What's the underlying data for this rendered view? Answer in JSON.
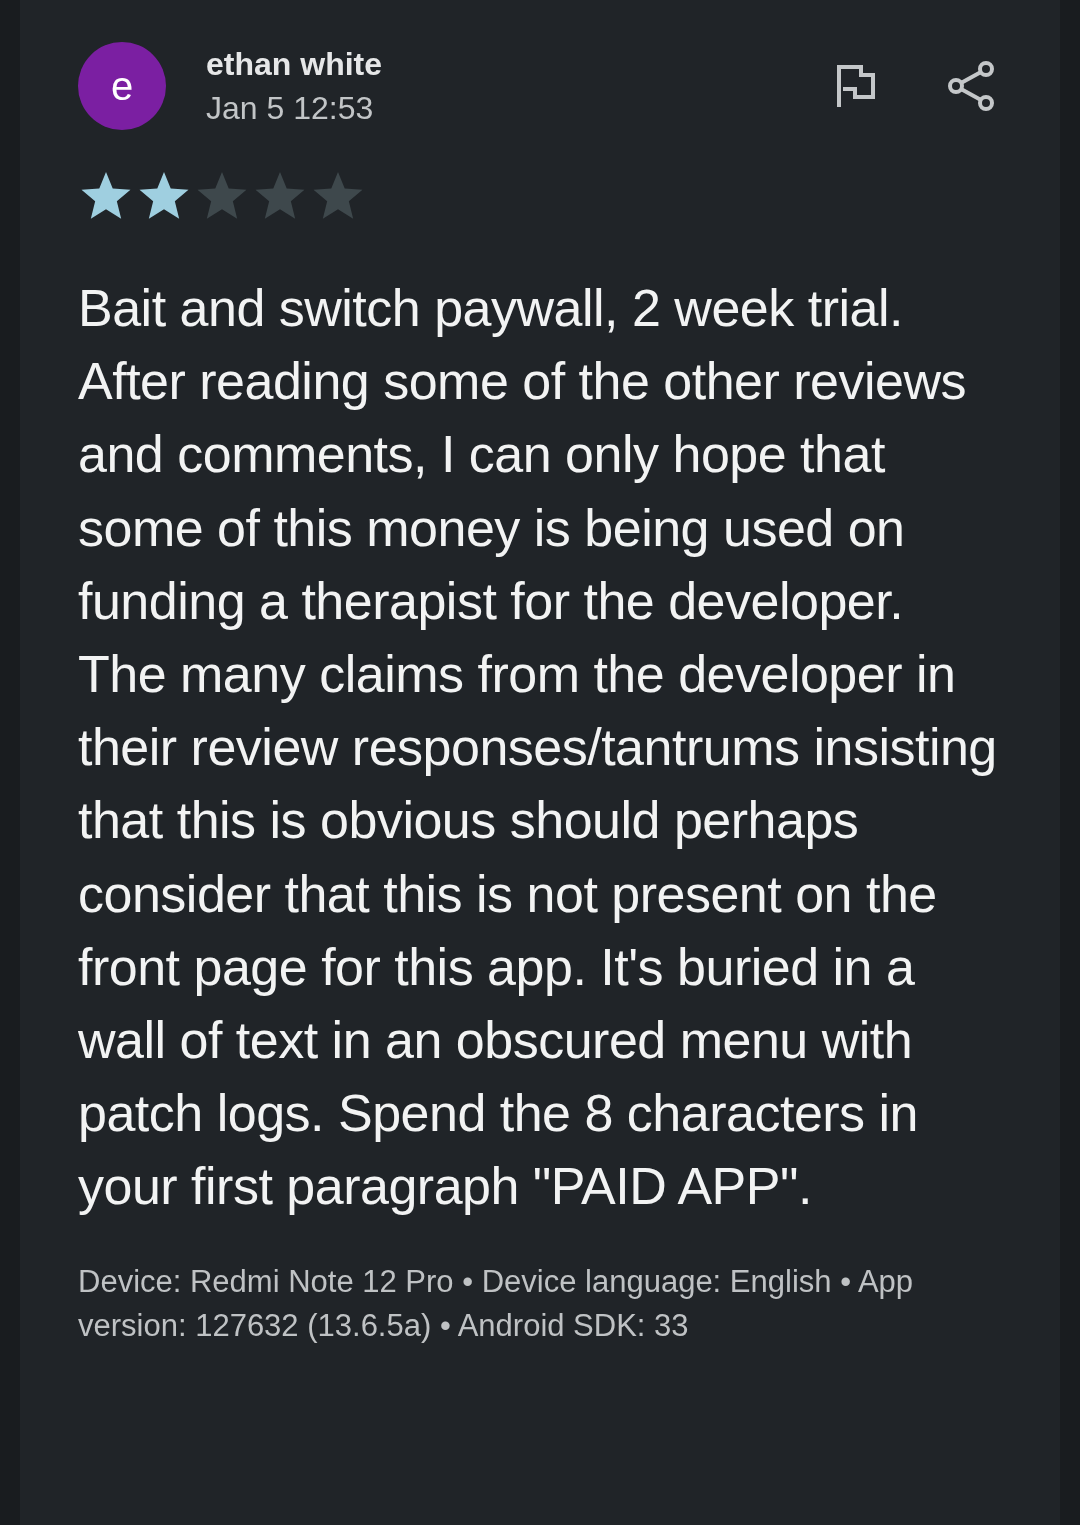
{
  "review": {
    "avatar_letter": "e",
    "author": "ethan white",
    "date": "Jan 5 12:53",
    "stars": 2,
    "text": "Bait and switch paywall, 2 week trial. After reading some of the other reviews and comments, I can only hope that some of this money is being used on funding a therapist for the developer. The many claims from the developer in their review responses/tantrums insisting that this is obvious should perhaps consider that this is not present on the front page for this app. It's buried in a wall of text in an obscured menu with patch logs. Spend the 8 characters in your first paragraph \"PAID APP\".",
    "device_info": "Device: Redmi Note 12 Pro • Device language: English • App version: 127632 (13.6.5a) • Android SDK: 33"
  }
}
